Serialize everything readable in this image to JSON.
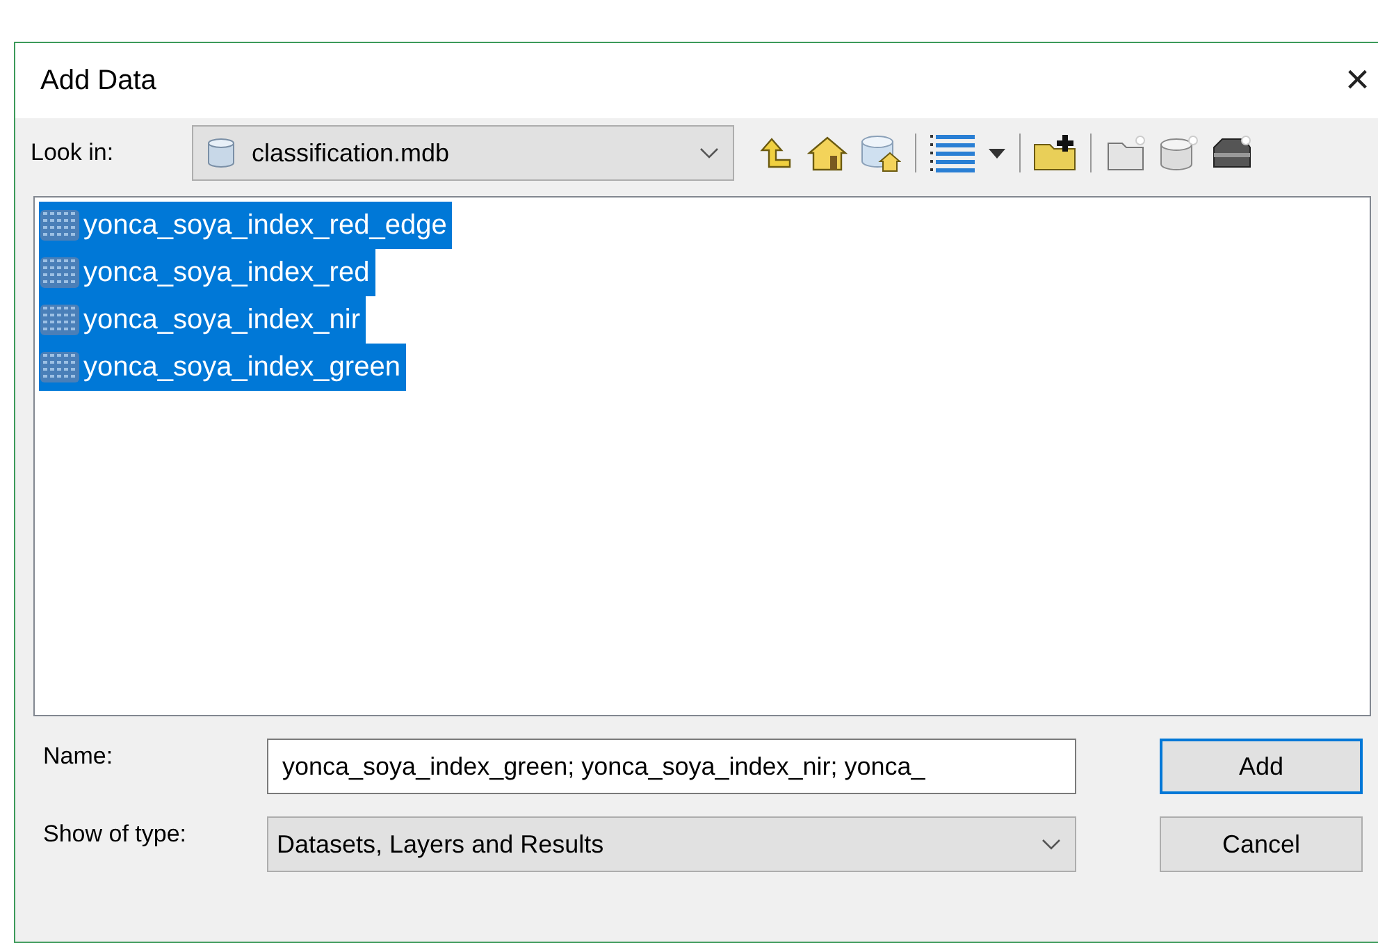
{
  "window": {
    "title": "Add Data",
    "close": "×"
  },
  "look_in": {
    "label": "Look in:",
    "value": "classification.mdb"
  },
  "items": [
    {
      "name": "yonca_soya_index_red_edge",
      "selected": true
    },
    {
      "name": "yonca_soya_index_red",
      "selected": true
    },
    {
      "name": "yonca_soya_index_nir",
      "selected": true
    },
    {
      "name": "yonca_soya_index_green",
      "selected": true
    }
  ],
  "name_field": {
    "label": "Name:",
    "value": "yonca_soya_index_green; yonca_soya_index_nir; yonca_"
  },
  "type_field": {
    "label": "Show of type:",
    "value": "Datasets, Layers and Results"
  },
  "buttons": [
    {
      "label": "Add",
      "default": true
    },
    {
      "label": "Cancel",
      "default": false
    }
  ]
}
